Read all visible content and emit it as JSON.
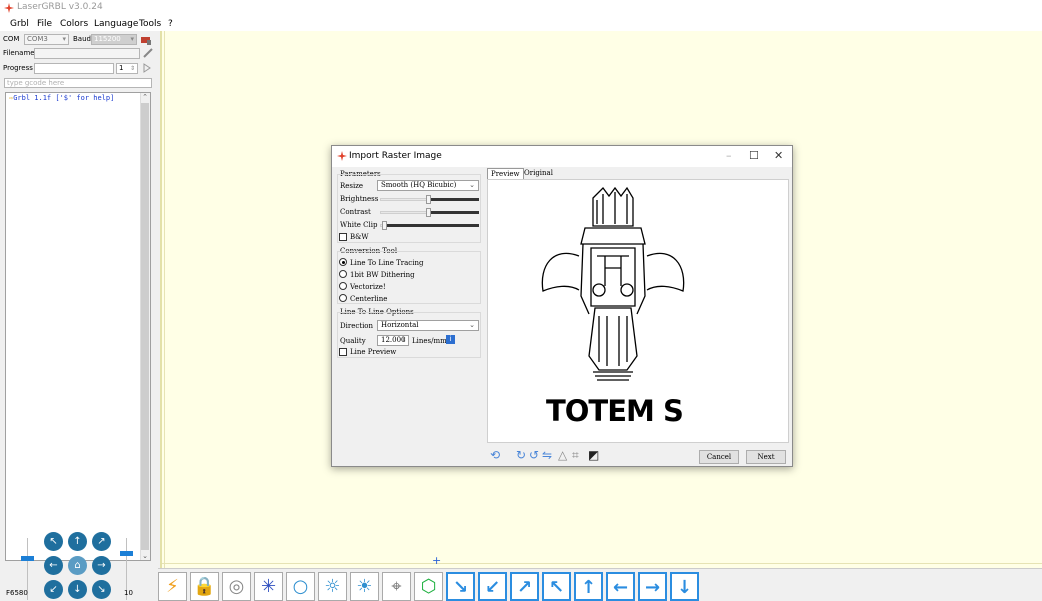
{
  "app": {
    "title": "LaserGRBL v3.0.24"
  },
  "menu": [
    "Grbl",
    "File",
    "Colors",
    "Language",
    "Tools",
    "?"
  ],
  "connection": {
    "com_label": "COM",
    "com_value": "COM3",
    "baud_label": "Baud",
    "baud_value": "115200",
    "filename_label": "Filename",
    "filename_value": "",
    "progress_label": "Progress",
    "progress_value": "",
    "copies_value": "1",
    "gcode_placeholder": "type gcode here"
  },
  "console": {
    "lines": [
      "Grbl 1.1f ['$' for help]"
    ]
  },
  "jog": {
    "feed_label": "F6580",
    "step_label": "10"
  },
  "dialog": {
    "title": "Import Raster Image",
    "params_title": "Parameters",
    "resize_label": "Resize",
    "resize_value": "Smooth (HQ Bicubic)",
    "brightness_label": "Brightness",
    "contrast_label": "Contrast",
    "whiteclip_label": "White Clip",
    "bw_label": "B&W",
    "conversion_title": "Conversion Tool",
    "conv_options": [
      "Line To Line Tracing",
      "1bit BW Dithering",
      "Vectorize!",
      "Centerline"
    ],
    "conv_selected": 0,
    "l2l_title": "Line To Line Options",
    "direction_label": "Direction",
    "direction_value": "Horizontal",
    "quality_label": "Quality",
    "quality_value": "12.000",
    "quality_unit": "Lines/mm",
    "line_preview_label": "Line Preview",
    "tab_preview": "Preview",
    "tab_original": "Original",
    "preview_text": "TOTEM S",
    "cancel_label": "Cancel",
    "next_label": "Next"
  },
  "colors": {
    "accent": "#2b8de0",
    "canvas": "#ffffe6",
    "console_text": "#1a3ad0",
    "jog": "#1f6f9e"
  }
}
